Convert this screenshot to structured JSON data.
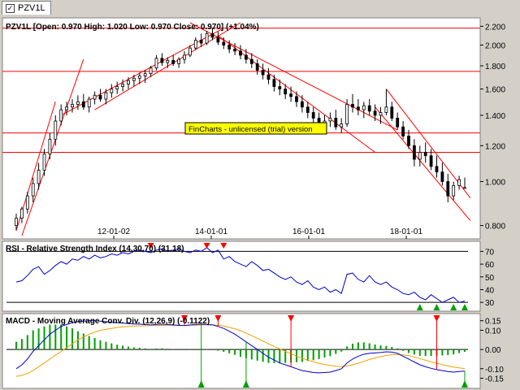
{
  "window": {
    "tab_label": "PZV1L"
  },
  "watermark": "FinCharts - unlicensed (trial) version",
  "colors": {
    "background": "#ffffff",
    "candle_up": "#ffffff",
    "candle_down": "#000000",
    "trendline": "#ff0000",
    "rsi_line": "#0000cc",
    "macd_line": "#0000cc",
    "signal_line": "#f0a000",
    "histogram": "#00a000",
    "watermark_bg": "#ffff00"
  },
  "chart_data": [
    {
      "type": "candlestick",
      "panel": "price",
      "title": "PZV1L [Open: 0.970  High: 1.020  Low: 0.970  Close: 0.970] (+1.04%)",
      "x_tick_labels": [
        "12-01-02",
        "14-01-01",
        "16-01-01",
        "18-01-01"
      ],
      "y_tick_labels": [
        "0.800",
        "1.000",
        "1.200",
        "1.400",
        "1.600",
        "1.800",
        "2.000",
        "2.200"
      ],
      "y_ticks": [
        0.8,
        1.0,
        1.2,
        1.4,
        1.6,
        1.8,
        2.0,
        2.2
      ],
      "ylim": [
        0.76,
        2.24
      ],
      "log_scale": true,
      "candles": [
        [
          0.8,
          0.85,
          0.78,
          0.83
        ],
        [
          0.83,
          0.88,
          0.81,
          0.87
        ],
        [
          0.87,
          0.95,
          0.85,
          0.93
        ],
        [
          0.93,
          1.02,
          0.9,
          0.99
        ],
        [
          0.99,
          1.1,
          0.96,
          1.06
        ],
        [
          1.06,
          1.18,
          1.03,
          1.15
        ],
        [
          1.15,
          1.28,
          1.12,
          1.24
        ],
        [
          1.24,
          1.4,
          1.2,
          1.36
        ],
        [
          1.36,
          1.48,
          1.33,
          1.44
        ],
        [
          1.44,
          1.5,
          1.4,
          1.46
        ],
        [
          1.46,
          1.52,
          1.42,
          1.48
        ],
        [
          1.48,
          1.55,
          1.44,
          1.5
        ],
        [
          1.5,
          1.56,
          1.44,
          1.46
        ],
        [
          1.46,
          1.54,
          1.42,
          1.52
        ],
        [
          1.52,
          1.58,
          1.48,
          1.55
        ],
        [
          1.55,
          1.6,
          1.5,
          1.52
        ],
        [
          1.52,
          1.6,
          1.48,
          1.57
        ],
        [
          1.57,
          1.64,
          1.53,
          1.6
        ],
        [
          1.6,
          1.66,
          1.56,
          1.62
        ],
        [
          1.62,
          1.68,
          1.58,
          1.64
        ],
        [
          1.64,
          1.7,
          1.6,
          1.67
        ],
        [
          1.67,
          1.72,
          1.62,
          1.69
        ],
        [
          1.69,
          1.74,
          1.64,
          1.71
        ],
        [
          1.71,
          1.76,
          1.65,
          1.73
        ],
        [
          1.73,
          1.8,
          1.7,
          1.78
        ],
        [
          1.78,
          1.9,
          1.76,
          1.87
        ],
        [
          1.87,
          1.92,
          1.8,
          1.83
        ],
        [
          1.83,
          1.88,
          1.78,
          1.85
        ],
        [
          1.85,
          1.9,
          1.8,
          1.82
        ],
        [
          1.82,
          1.88,
          1.78,
          1.86
        ],
        [
          1.86,
          1.94,
          1.82,
          1.9
        ],
        [
          1.9,
          2.0,
          1.88,
          1.97
        ],
        [
          1.97,
          2.08,
          1.95,
          2.05
        ],
        [
          2.05,
          2.12,
          1.98,
          2.02
        ],
        [
          2.02,
          2.15,
          2.0,
          2.12
        ],
        [
          2.12,
          2.18,
          2.05,
          2.08
        ],
        [
          2.08,
          2.14,
          2.0,
          2.03
        ],
        [
          2.03,
          2.08,
          1.96,
          2.0
        ],
        [
          2.0,
          2.05,
          1.92,
          1.96
        ],
        [
          1.96,
          2.02,
          1.9,
          1.94
        ],
        [
          1.94,
          2.0,
          1.86,
          1.9
        ],
        [
          1.9,
          1.96,
          1.82,
          1.86
        ],
        [
          1.86,
          1.92,
          1.78,
          1.82
        ],
        [
          1.82,
          1.86,
          1.72,
          1.76
        ],
        [
          1.76,
          1.82,
          1.68,
          1.72
        ],
        [
          1.72,
          1.78,
          1.64,
          1.68
        ],
        [
          1.68,
          1.72,
          1.58,
          1.62
        ],
        [
          1.62,
          1.68,
          1.55,
          1.6
        ],
        [
          1.6,
          1.64,
          1.52,
          1.56
        ],
        [
          1.56,
          1.62,
          1.5,
          1.54
        ],
        [
          1.54,
          1.58,
          1.46,
          1.5
        ],
        [
          1.5,
          1.55,
          1.42,
          1.46
        ],
        [
          1.46,
          1.5,
          1.38,
          1.42
        ],
        [
          1.42,
          1.46,
          1.34,
          1.38
        ],
        [
          1.38,
          1.42,
          1.31,
          1.34
        ],
        [
          1.34,
          1.4,
          1.3,
          1.36
        ],
        [
          1.36,
          1.42,
          1.32,
          1.38
        ],
        [
          1.38,
          1.44,
          1.3,
          1.32
        ],
        [
          1.32,
          1.38,
          1.28,
          1.34
        ],
        [
          1.34,
          1.52,
          1.32,
          1.48
        ],
        [
          1.48,
          1.56,
          1.42,
          1.46
        ],
        [
          1.46,
          1.52,
          1.4,
          1.44
        ],
        [
          1.44,
          1.5,
          1.38,
          1.47
        ],
        [
          1.47,
          1.52,
          1.4,
          1.43
        ],
        [
          1.43,
          1.48,
          1.36,
          1.4
        ],
        [
          1.4,
          1.46,
          1.34,
          1.42
        ],
        [
          1.42,
          1.6,
          1.4,
          1.46
        ],
        [
          1.46,
          1.5,
          1.36,
          1.38
        ],
        [
          1.38,
          1.42,
          1.3,
          1.32
        ],
        [
          1.32,
          1.36,
          1.24,
          1.26
        ],
        [
          1.26,
          1.3,
          1.18,
          1.2
        ],
        [
          1.2,
          1.24,
          1.08,
          1.12
        ],
        [
          1.12,
          1.2,
          1.08,
          1.16
        ],
        [
          1.16,
          1.22,
          1.1,
          1.14
        ],
        [
          1.14,
          1.18,
          1.06,
          1.08
        ],
        [
          1.08,
          1.14,
          1.02,
          1.05
        ],
        [
          1.05,
          1.1,
          0.98,
          1.0
        ],
        [
          1.0,
          1.04,
          0.9,
          0.93
        ],
        [
          0.93,
          1.0,
          0.91,
          0.98
        ],
        [
          0.98,
          1.03,
          0.96,
          1.01
        ],
        [
          0.97,
          1.02,
          0.97,
          0.97
        ]
      ],
      "trendlines": [
        {
          "from": [
            0,
            0.78
          ],
          "to": [
            7,
            1.5
          ]
        },
        {
          "from": [
            1,
            0.76
          ],
          "to": [
            12,
            1.86
          ]
        },
        {
          "from": [
            8,
            1.4
          ],
          "to": [
            37,
            2.18
          ]
        },
        {
          "from": [
            14,
            1.44
          ],
          "to": [
            40,
            2.24
          ]
        },
        {
          "from": [
            31,
            2.24
          ],
          "to": [
            68,
            1.3
          ]
        },
        {
          "from": [
            36,
            2.1
          ],
          "to": [
            64,
            1.16
          ]
        },
        {
          "from": [
            66,
            1.6
          ],
          "to": [
            81,
            0.92
          ]
        },
        {
          "from": [
            64,
            1.46
          ],
          "to": [
            81,
            0.82
          ]
        }
      ],
      "horizontal_lines": [
        2.18,
        1.75,
        1.28,
        1.16
      ]
    },
    {
      "type": "line",
      "panel": "rsi",
      "title": "RSI - Relative Strength Index (14,30,70) (31.18)",
      "y_tick_labels": [
        "30",
        "40",
        "50",
        "60",
        "70"
      ],
      "y_ticks": [
        30,
        40,
        50,
        60,
        70
      ],
      "ylim": [
        25,
        76
      ],
      "overbought": 70,
      "oversold": 30,
      "values": [
        46,
        47,
        51,
        56,
        58,
        52,
        55,
        59,
        62,
        60,
        64,
        63,
        66,
        64,
        67,
        65,
        66,
        68,
        67,
        69,
        68,
        70,
        71,
        70,
        69,
        71,
        72,
        70,
        71,
        72,
        70,
        69,
        71,
        70,
        73,
        69,
        71,
        64,
        66,
        62,
        60,
        58,
        62,
        59,
        55,
        56,
        53,
        50,
        48,
        50,
        46,
        44,
        47,
        42,
        40,
        42,
        38,
        40,
        37,
        52,
        53,
        48,
        46,
        51,
        46,
        44,
        46,
        42,
        40,
        37,
        36,
        38,
        34,
        32,
        36,
        33,
        30,
        32,
        34,
        30,
        31
      ],
      "sell_markers": [
        24,
        34,
        37
      ],
      "buy_markers": [
        72,
        75,
        78,
        80
      ]
    },
    {
      "type": "bar+line",
      "panel": "macd",
      "title": "MACD - Moving Average Conv. Div. (12,26,9) (-0.1122)",
      "y_tick_labels": [
        "0.15",
        "0.10",
        "0.00",
        "-0.10",
        "-0.15"
      ],
      "y_ticks": [
        0.15,
        0.1,
        0.0,
        -0.1,
        -0.15
      ],
      "ylim": [
        -0.19,
        0.17
      ],
      "series": [
        {
          "values": [
            -0.1,
            -0.08,
            -0.05,
            -0.01,
            0.02,
            0.05,
            0.08,
            0.1,
            0.12,
            0.13,
            0.14,
            0.145,
            0.148,
            0.15,
            0.15,
            0.148,
            0.145,
            0.142,
            0.14,
            0.138,
            0.135,
            0.133,
            0.132,
            0.13,
            0.128,
            0.13,
            0.132,
            0.13,
            0.128,
            0.126,
            0.125,
            0.128,
            0.13,
            0.132,
            0.13,
            0.128,
            0.12,
            0.11,
            0.095,
            0.08,
            0.06,
            0.04,
            0.02,
            0.0,
            -0.02,
            -0.04,
            -0.055,
            -0.07,
            -0.08,
            -0.09,
            -0.1,
            -0.11,
            -0.115,
            -0.12,
            -0.122,
            -0.12,
            -0.118,
            -0.11,
            -0.1,
            -0.07,
            -0.05,
            -0.035,
            -0.025,
            -0.02,
            -0.018,
            -0.016,
            -0.012,
            -0.014,
            -0.02,
            -0.035,
            -0.05,
            -0.065,
            -0.08,
            -0.09,
            -0.098,
            -0.105,
            -0.11,
            -0.115,
            -0.118,
            -0.115,
            -0.112
          ]
        },
        {
          "values": [
            -0.14,
            -0.135,
            -0.125,
            -0.11,
            -0.09,
            -0.07,
            -0.05,
            -0.03,
            -0.01,
            0.01,
            0.03,
            0.05,
            0.065,
            0.08,
            0.09,
            0.1,
            0.105,
            0.11,
            0.115,
            0.118,
            0.12,
            0.122,
            0.123,
            0.124,
            0.125,
            0.125,
            0.126,
            0.126,
            0.126,
            0.126,
            0.125,
            0.126,
            0.127,
            0.128,
            0.128,
            0.128,
            0.126,
            0.122,
            0.115,
            0.108,
            0.098,
            0.085,
            0.072,
            0.058,
            0.044,
            0.03,
            0.016,
            0.003,
            -0.01,
            -0.022,
            -0.034,
            -0.045,
            -0.055,
            -0.064,
            -0.072,
            -0.078,
            -0.083,
            -0.087,
            -0.089,
            -0.086,
            -0.08,
            -0.072,
            -0.062,
            -0.052,
            -0.044,
            -0.037,
            -0.031,
            -0.027,
            -0.026,
            -0.028,
            -0.032,
            -0.039,
            -0.047,
            -0.056,
            -0.064,
            -0.072,
            -0.079,
            -0.086,
            -0.092,
            -0.096,
            -0.1
          ]
        }
      ],
      "sell_markers": [
        30,
        36,
        49,
        75
      ],
      "buy_markers": [
        33,
        41,
        82
      ]
    }
  ]
}
